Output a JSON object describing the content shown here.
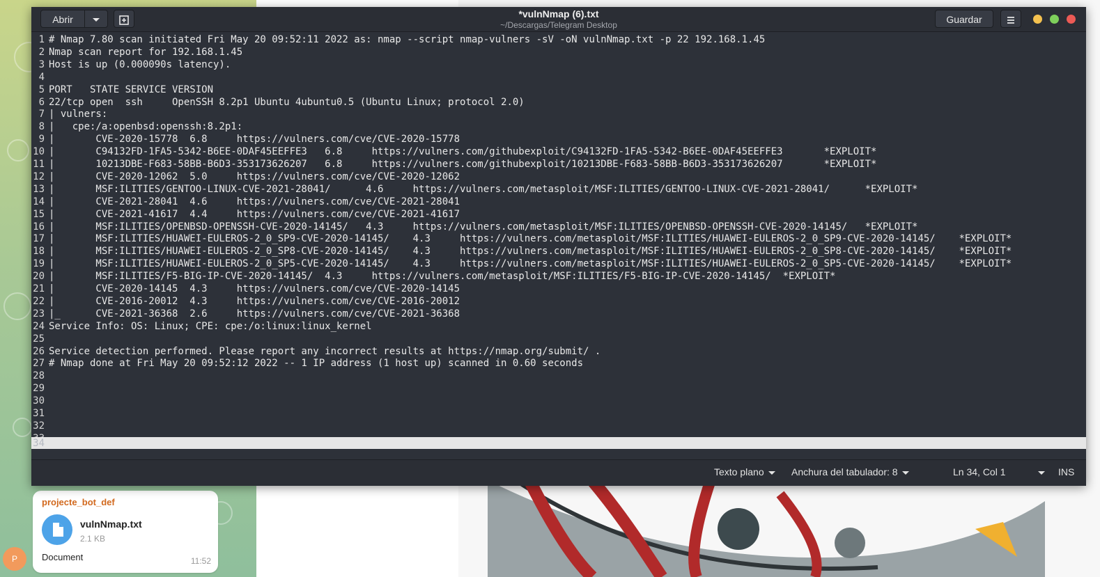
{
  "telegram": {
    "sender": "projecte_bot_def",
    "file_name": "vulnNmap.txt",
    "file_size": "2.1 KB",
    "caption": "Document",
    "time": "11:52",
    "avatar_letter": "P"
  },
  "window": {
    "title": "*vulnNmap (6).txt",
    "subtitle": "~/Descargas/Telegram Desktop",
    "open_label": "Abrir",
    "save_label": "Guardar"
  },
  "editor": {
    "lines": [
      {
        "n": "1",
        "t": "# Nmap 7.80 scan initiated Fri May 20 09:52:11 2022 as: nmap --script nmap-vulners -sV -oN vulnNmap.txt -p 22 192.168.1.45"
      },
      {
        "n": "2",
        "t": "Nmap scan report for 192.168.1.45"
      },
      {
        "n": "3",
        "t": "Host is up (0.000090s latency)."
      },
      {
        "n": "4",
        "t": ""
      },
      {
        "n": "5",
        "t": "PORT   STATE SERVICE VERSION"
      },
      {
        "n": "6",
        "t": "22/tcp open  ssh     OpenSSH 8.2p1 Ubuntu 4ubuntu0.5 (Ubuntu Linux; protocol 2.0)"
      },
      {
        "n": "7",
        "t": "| vulners:"
      },
      {
        "n": "8",
        "t": "|   cpe:/a:openbsd:openssh:8.2p1:"
      },
      {
        "n": "9",
        "t": "|       CVE-2020-15778  6.8     https://vulners.com/cve/CVE-2020-15778"
      },
      {
        "n": "10",
        "t": "|       C94132FD-1FA5-5342-B6EE-0DAF45EEFFE3   6.8     https://vulners.com/githubexploit/C94132FD-1FA5-5342-B6EE-0DAF45EEFFE3       *EXPLOIT*"
      },
      {
        "n": "11",
        "t": "|       10213DBE-F683-58BB-B6D3-353173626207   6.8     https://vulners.com/githubexploit/10213DBE-F683-58BB-B6D3-353173626207       *EXPLOIT*"
      },
      {
        "n": "12",
        "t": "|       CVE-2020-12062  5.0     https://vulners.com/cve/CVE-2020-12062"
      },
      {
        "n": "13",
        "t": "|       MSF:ILITIES/GENTOO-LINUX-CVE-2021-28041/      4.6     https://vulners.com/metasploit/MSF:ILITIES/GENTOO-LINUX-CVE-2021-28041/      *EXPLOIT*"
      },
      {
        "n": "14",
        "t": "|       CVE-2021-28041  4.6     https://vulners.com/cve/CVE-2021-28041"
      },
      {
        "n": "15",
        "t": "|       CVE-2021-41617  4.4     https://vulners.com/cve/CVE-2021-41617"
      },
      {
        "n": "16",
        "t": "|       MSF:ILITIES/OPENBSD-OPENSSH-CVE-2020-14145/   4.3     https://vulners.com/metasploit/MSF:ILITIES/OPENBSD-OPENSSH-CVE-2020-14145/   *EXPLOIT*"
      },
      {
        "n": "17",
        "t": "|       MSF:ILITIES/HUAWEI-EULEROS-2_0_SP9-CVE-2020-14145/    4.3     https://vulners.com/metasploit/MSF:ILITIES/HUAWEI-EULEROS-2_0_SP9-CVE-2020-14145/    *EXPLOIT*"
      },
      {
        "n": "18",
        "t": "|       MSF:ILITIES/HUAWEI-EULEROS-2_0_SP8-CVE-2020-14145/    4.3     https://vulners.com/metasploit/MSF:ILITIES/HUAWEI-EULEROS-2_0_SP8-CVE-2020-14145/    *EXPLOIT*"
      },
      {
        "n": "19",
        "t": "|       MSF:ILITIES/HUAWEI-EULEROS-2_0_SP5-CVE-2020-14145/    4.3     https://vulners.com/metasploit/MSF:ILITIES/HUAWEI-EULEROS-2_0_SP5-CVE-2020-14145/    *EXPLOIT*"
      },
      {
        "n": "20",
        "t": "|       MSF:ILITIES/F5-BIG-IP-CVE-2020-14145/  4.3     https://vulners.com/metasploit/MSF:ILITIES/F5-BIG-IP-CVE-2020-14145/  *EXPLOIT*"
      },
      {
        "n": "21",
        "t": "|       CVE-2020-14145  4.3     https://vulners.com/cve/CVE-2020-14145"
      },
      {
        "n": "22",
        "t": "|       CVE-2016-20012  4.3     https://vulners.com/cve/CVE-2016-20012"
      },
      {
        "n": "23",
        "t": "|_      CVE-2021-36368  2.6     https://vulners.com/cve/CVE-2021-36368"
      },
      {
        "n": "24",
        "t": "Service Info: OS: Linux; CPE: cpe:/o:linux:linux_kernel"
      },
      {
        "n": "25",
        "t": ""
      },
      {
        "n": "26",
        "t": "Service detection performed. Please report any incorrect results at https://nmap.org/submit/ ."
      },
      {
        "n": "27",
        "t": "# Nmap done at Fri May 20 09:52:12 2022 -- 1 IP address (1 host up) scanned in 0.60 seconds"
      },
      {
        "n": "28",
        "t": ""
      },
      {
        "n": "29",
        "t": ""
      },
      {
        "n": "30",
        "t": ""
      },
      {
        "n": "31",
        "t": ""
      },
      {
        "n": "32",
        "t": ""
      },
      {
        "n": "33",
        "t": ""
      }
    ],
    "current_line_number": "34"
  },
  "statusbar": {
    "language": "Texto plano",
    "tab_width": "Anchura del tabulador: 8",
    "position": "Ln 34, Col 1",
    "mode": "INS"
  },
  "icons": {
    "open_menu": "chevron-down-icon",
    "new_tab": "new-tab-icon",
    "menu": "hamburger-menu-icon",
    "file": "document-icon"
  },
  "colors": {
    "editor_bg": "#2d3139",
    "current_line_bg": "#e6e6e6",
    "window_minimize": "#f4c14f",
    "window_maximize": "#7ecf5b",
    "window_close": "#ec5a55",
    "telegram_file_icon": "#4da3e8",
    "telegram_sender": "#d2691e"
  }
}
